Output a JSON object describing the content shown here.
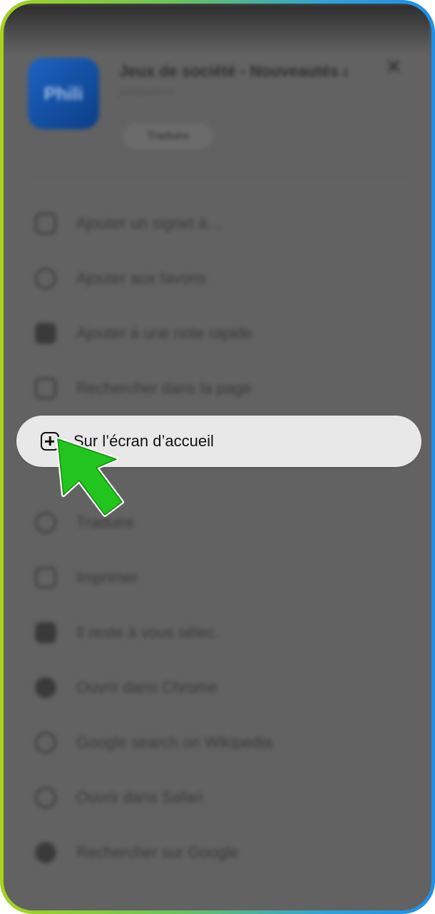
{
  "app_header": {
    "title": "Jeux de société - Nouveautés a…",
    "subtitle": "philibertnet",
    "icon_label": "Phili",
    "pill_label": "Traduire"
  },
  "menu": {
    "items": [
      {
        "label": "Ajouter un signet à…",
        "icon": "bookmark-icon"
      },
      {
        "label": "Ajouter aux favoris",
        "icon": "star-icon"
      },
      {
        "label": "Ajouter à une note rapide",
        "icon": "note-icon"
      },
      {
        "label": "Rechercher dans la page",
        "icon": "search-page-icon"
      },
      {
        "label": "Sur l’écran d’accueil",
        "icon": "add-square-icon",
        "highlighted": true
      },
      {
        "label": "Traduire",
        "icon": "translate-icon"
      },
      {
        "label": "Imprimer",
        "icon": "printer-icon"
      },
      {
        "label": "Il reste à vous sélec.",
        "icon": "folder-icon"
      },
      {
        "label": "Ouvrir dans Chrome",
        "icon": "chrome-icon"
      },
      {
        "label": "Google search on Wikipedia",
        "icon": "globe-icon"
      },
      {
        "label": "Ouvrir dans Safari",
        "icon": "compass-icon"
      },
      {
        "label": "Rechercher sur Google",
        "icon": "google-icon"
      }
    ]
  },
  "colors": {
    "overlay": "#626262",
    "highlight_bg": "#e8e8e8",
    "pointer_green": "#22c51d",
    "frame_gradient_start": "#a6d31c",
    "frame_gradient_end": "#1d8fe8"
  }
}
